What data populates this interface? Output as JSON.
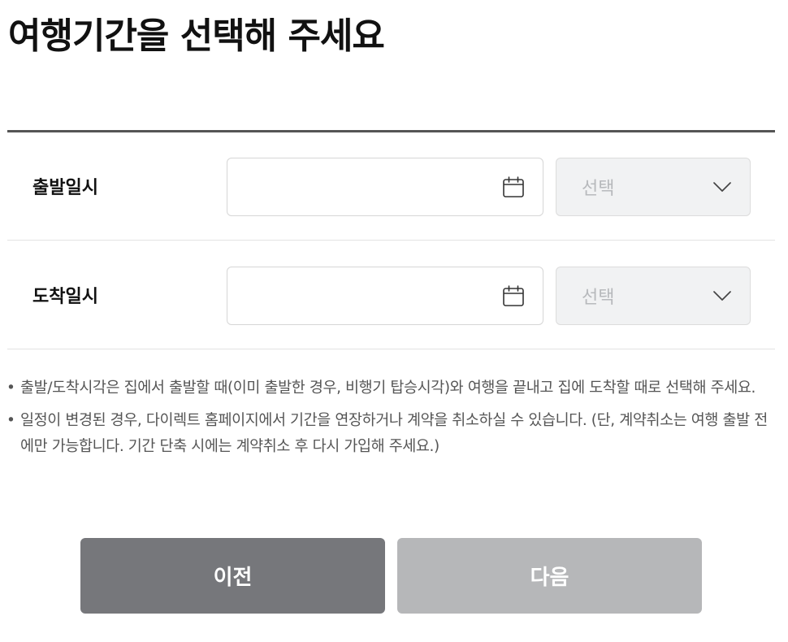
{
  "page": {
    "title": "여행기간을 선택해 주세요"
  },
  "departure": {
    "label": "출발일시",
    "date_value": "",
    "time_select": "선택",
    "calendar_icon": "calendar-icon",
    "chevron_icon": "chevron-down-icon"
  },
  "arrival": {
    "label": "도착일시",
    "date_value": "",
    "time_select": "선택",
    "calendar_icon": "calendar-icon",
    "chevron_icon": "chevron-down-icon"
  },
  "notes": [
    "출발/도착시각은 집에서 출발할 때(이미 출발한 경우, 비행기 탑승시각)와 여행을 끝내고 집에 도착할 때로 선택해 주세요.",
    "일정이 변경된 경우, 다이렉트 홈페이지에서 기간을 연장하거나 계약을 취소하실 수 있습니다. (단, 계약취소는 여행 출발 전에만 가능합니다. 기간 단축 시에는 계약취소 후 다시 가입해 주세요.)"
  ],
  "note_bullet": "•",
  "buttons": {
    "prev_label": "이전",
    "next_label": "다음"
  },
  "colors": {
    "prev_button": "#76777b",
    "next_button_disabled": "#b6b7b9",
    "select_bg": "#f1f2f3",
    "select_text": "#b7b9bc",
    "rule": "#555555"
  }
}
